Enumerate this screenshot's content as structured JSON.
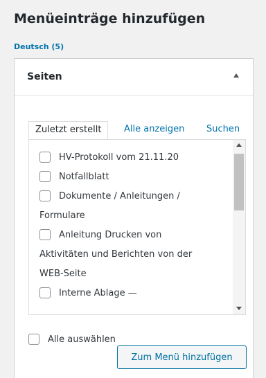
{
  "page": {
    "title": "Menüeinträge hinzufügen"
  },
  "language_link": "Deutsch (5)",
  "panel": {
    "title": "Seiten"
  },
  "tabs": [
    {
      "label": "Zuletzt erstellt",
      "active": true
    },
    {
      "label": "Alle anzeigen",
      "active": false
    },
    {
      "label": "Suchen",
      "active": false
    }
  ],
  "items": [
    {
      "line1": "HV-Protokoll vom 21.11.20"
    },
    {
      "line1": "Notfallblatt"
    },
    {
      "line1": "Dokumente / Anleitungen /",
      "line2": "Formulare"
    },
    {
      "line1": "Anleitung Drucken von",
      "line2": "Aktivitäten und Berichten von der",
      "line3": "WEB-Seite"
    },
    {
      "line1": "Interne Ablage —"
    }
  ],
  "select_all_label": "Alle auswählen",
  "add_button_label": "Zum Menü hinzufügen"
}
